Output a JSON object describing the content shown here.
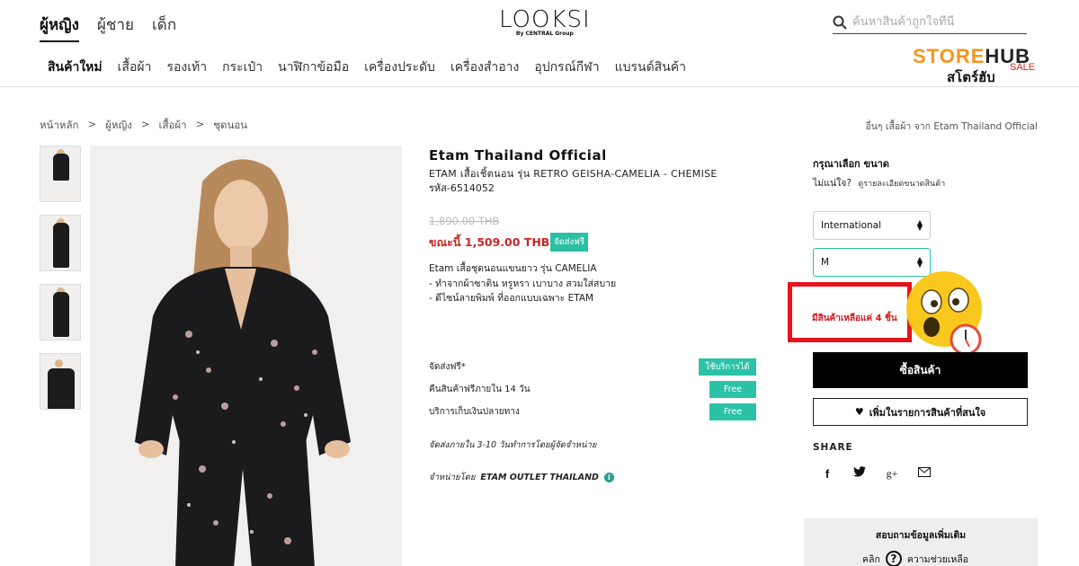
{
  "header": {
    "gender_tabs": [
      "ผู้หญิง",
      "ผู้ชาย",
      "เด็ก"
    ],
    "logo_main": "LOOKSI",
    "logo_sub": "By CENTRAL Group",
    "search_placeholder": "ค้นหาสินค้าถูกใจที่นี่",
    "categories": [
      "สินค้าใหม่",
      "เสื้อผ้า",
      "รองเท้า",
      "กระเป๋า",
      "นาฬิกาข้อมือ",
      "เครื่องประดับ",
      "เครื่องสำอาง",
      "อุปกรณ์กีฬา",
      "แบรนด์สินค้า"
    ],
    "storehub": {
      "word_a": "STORE",
      "word_b": "HUB",
      "sale": "SALE",
      "thai": "สโตร์ฮับ"
    }
  },
  "breadcrumb": {
    "items": [
      "หน้าหลัก",
      "ผู้หญิง",
      "เสื้อผ้า",
      "ชุดนอน"
    ],
    "separator": ">",
    "related": "อื่นๆ เสื้อผ้า จาก Etam Thailand Official"
  },
  "product": {
    "brand": "Etam Thailand Official",
    "name": "ETAM เสื้อเชิ้ตนอน รุ่น RETRO GEISHA-CAMELIA - CHEMISE",
    "sku": "รหัส-6514052",
    "old_price": "1,890.00 THB",
    "new_price": "ขณะนี้ 1,509.00 THB",
    "free_ship_badge": "จัดส่งฟรี",
    "description": [
      "Etam เสื้อชุดนอนแขนยาว รุ่น CAMELIA",
      "- ทำจากผ้าซาติน หรูหรา เบาบาง สวมใส่สบาย",
      "- ดีไซน์ลายพิมพ์ ที่ออกแบบเฉพาะ ETAM"
    ],
    "services": [
      {
        "label": "จัดส่งฟรี*",
        "tag": "ใช้บริการได้"
      },
      {
        "label": "คืนสินค้าฟรีภายใน 14 วัน",
        "tag": "Free"
      },
      {
        "label": "บริการเก็บเงินปลายทาง",
        "tag": "Free"
      }
    ],
    "ship_note": "จัดส่งภายใน 3-10 วันทำการโดยผู้จัดจำหน่าย",
    "seller_prefix": "จำหน่ายโดย",
    "seller_name": "ETAM OUTLET THAILAND"
  },
  "purchase": {
    "size_label": "กรุณาเลือก ขนาด",
    "size_help_q": "ไม่แน่ใจ?",
    "size_help_link": "ดูรายละเอียดขนาดสินค้า",
    "size_system": "International",
    "size_value": "M",
    "stock_text": "มีสินค้าเหลือแค่ 4 ชิ้น",
    "buy_label": "ซื้อสินค้า",
    "wishlist_label": "เพิ่มในรายการสินค้าที่สนใจ",
    "share_label": "SHARE",
    "share_icons": [
      "f",
      "twitter",
      "g+",
      "email"
    ],
    "help_title": "สอบถามข้อมูลเพิ่มเติม",
    "help_prefix": "คลิก",
    "help_link": "ความช่วยเหลือ"
  },
  "colors": {
    "accent": "#2bc2a8",
    "price_red": "#c62828",
    "alert_red": "#e5131b",
    "brand_orange": "#f7941d"
  }
}
